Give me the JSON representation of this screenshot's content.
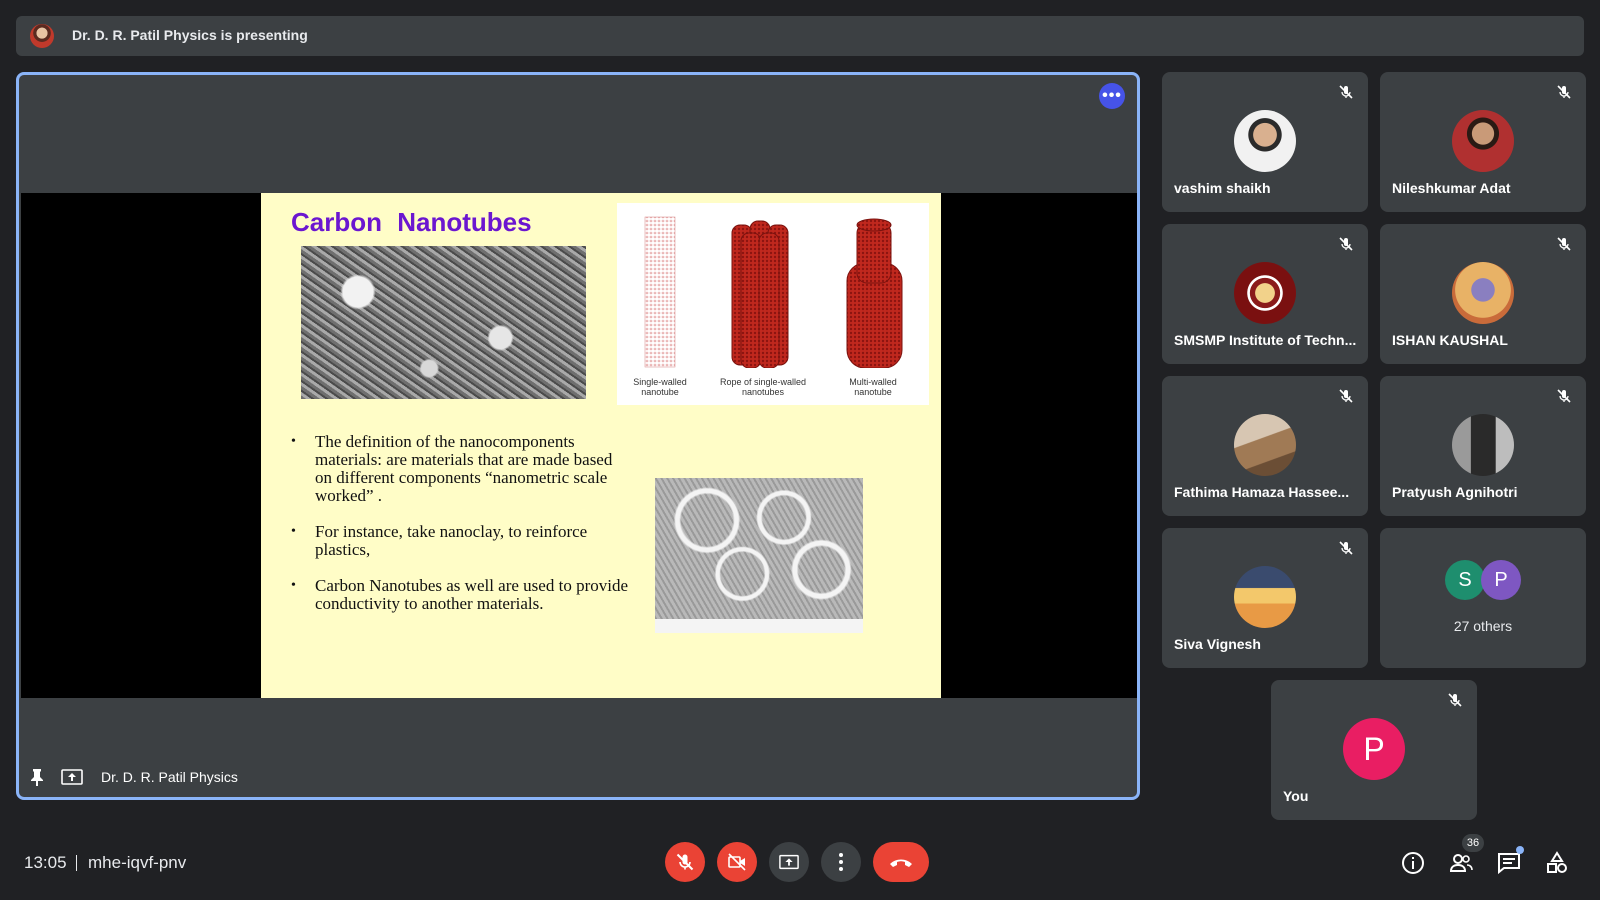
{
  "banner": {
    "text": "Dr. D. R. Patil Physics is presenting"
  },
  "stage": {
    "presenter_name": "Dr. D. R. Patil Physics"
  },
  "slide": {
    "title": "Carbon  Nanotubes",
    "figure_captions": [
      "Single-walled nanotube",
      "Rope of single-walled nanotubes",
      "Multi-walled nanotube"
    ],
    "bullets": [
      "The definition of the nanocomponents materials: are materials that are made based on different components “nanometric scale worked” .",
      "For instance, take nanoclay, to reinforce plastics,",
      "Carbon Nanotubes  as well are used to provide conductivity to another materials."
    ]
  },
  "participants": [
    {
      "name": "vashim shaikh",
      "muted": true
    },
    {
      "name": "Nileshkumar Adat",
      "muted": true
    },
    {
      "name": "SMSMP Institute of Techn...",
      "muted": true
    },
    {
      "name": "ISHAN KAUSHAL",
      "muted": true
    },
    {
      "name": "Fathima Hamaza Hassee...",
      "muted": true
    },
    {
      "name": "Pratyush Agnihotri",
      "muted": true
    },
    {
      "name": "Siva Vignesh",
      "muted": true
    }
  ],
  "others_tile": {
    "initials": [
      "S",
      "P"
    ],
    "label": "27 others"
  },
  "self_tile": {
    "initial": "P",
    "name": "You"
  },
  "bottom": {
    "time": "13:05",
    "meeting_code": "mhe-iqvf-pnv",
    "people_count": "36"
  },
  "colors": {
    "accent": "#8ab4f8",
    "danger": "#ea4335",
    "self_avatar": "#e91e63",
    "others_s": "#1e8e6e",
    "others_p": "#7e57c2"
  }
}
